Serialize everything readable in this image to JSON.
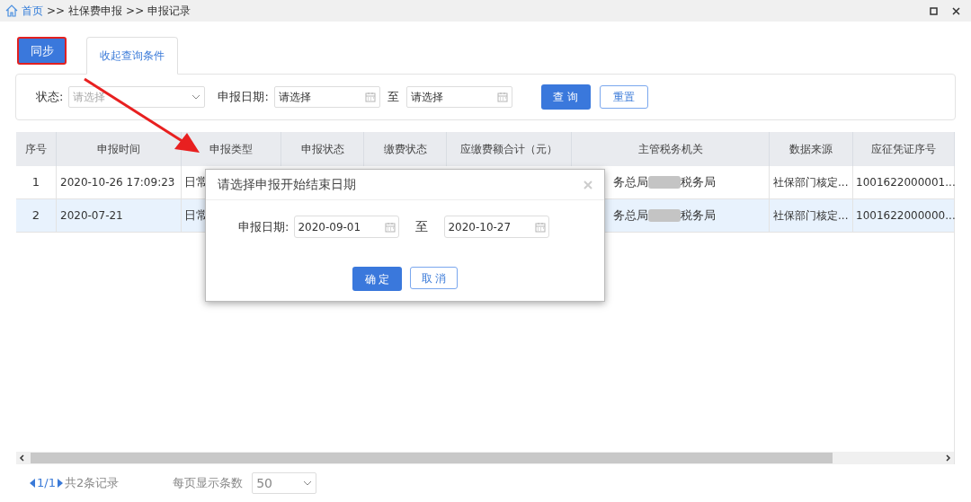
{
  "breadcrumb": [
    {
      "label": "首页",
      "link": true
    },
    {
      "label": ">>",
      "link": false
    },
    {
      "label": "社保费申报",
      "link": false
    },
    {
      "label": ">>",
      "link": false
    },
    {
      "label": "申报记录",
      "link": false
    }
  ],
  "sync_button": "同步",
  "collapse_tab": "收起查询条件",
  "filters": {
    "status_label": "状态:",
    "status_placeholder": "请选择",
    "date_label": "申报日期:",
    "date_from_placeholder": "请选择",
    "to": "至",
    "date_to_placeholder": "请选择",
    "query_button": "查 询",
    "reset_button": "重置"
  },
  "table": {
    "columns": [
      "序号",
      "申报时间",
      "申报类型",
      "申报状态",
      "缴费状态",
      "应缴费额合计（元）",
      "主管税务机关",
      "数据来源",
      "应征凭证序号"
    ],
    "rows": [
      {
        "selected": false,
        "no": "1",
        "time": "2020-10-26 17:09:23",
        "type": "日常",
        "office_a": "务总局",
        "office_b": "税务局",
        "source": "社保部门核定...",
        "voucher": "1001622000001..."
      },
      {
        "selected": true,
        "no": "2",
        "time": "2020-07-21",
        "type": "日常",
        "office_a": "务总局",
        "office_b": "税务局",
        "source": "社保部门核定...",
        "voucher": "1001622000000..."
      }
    ]
  },
  "pagination": {
    "page": "1/1",
    "total": "共2条记录",
    "page_size_label": "每页显示条数",
    "page_size": "50"
  },
  "dialog": {
    "title": "请选择申报开始结束日期",
    "date_label": "申报日期:",
    "date_from": "2020-09-01",
    "to": "至",
    "date_to": "2020-10-27",
    "ok": "确 定",
    "cancel": "取 消"
  }
}
